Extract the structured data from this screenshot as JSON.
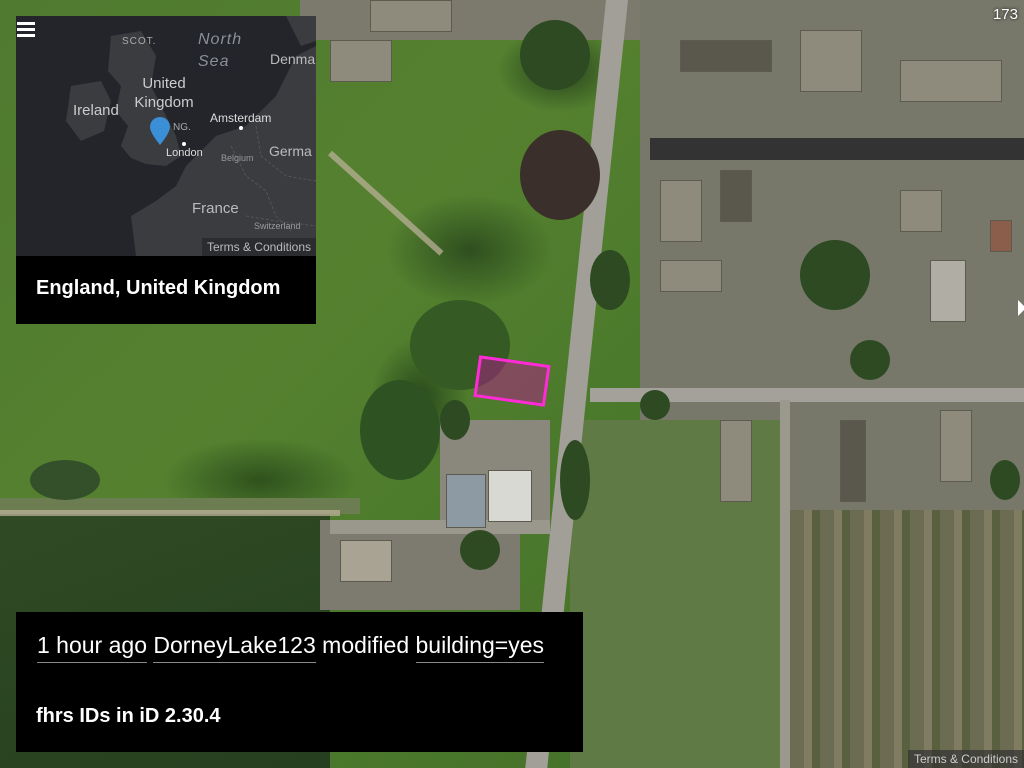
{
  "overview": {
    "menu_icon": "hamburger-menu-icon",
    "location_title": "England, United Kingdom",
    "terms": "Terms & Conditions",
    "map_labels": {
      "scot": "SCOT.",
      "north_sea": "North Sea",
      "denmark": "Denma",
      "ireland": "Ireland",
      "uk": "United Kingdom",
      "eng": "NG.",
      "amsterdam": "Amsterdam",
      "london": "London",
      "belgium": "Belgium",
      "germany": "Germa",
      "france": "France",
      "switzerland": "Switzerland"
    },
    "marker_icon": "location-pin-icon",
    "marker_color": "#3b8fd6"
  },
  "change": {
    "time": "1 hour ago",
    "user": "DorneyLake123",
    "action": "modified",
    "tag": "building=yes",
    "comment": "fhrs IDs in iD 2.30.4"
  },
  "counter": "173",
  "map_terms": "Terms & Conditions",
  "highlight_color": "#ff2bd6"
}
